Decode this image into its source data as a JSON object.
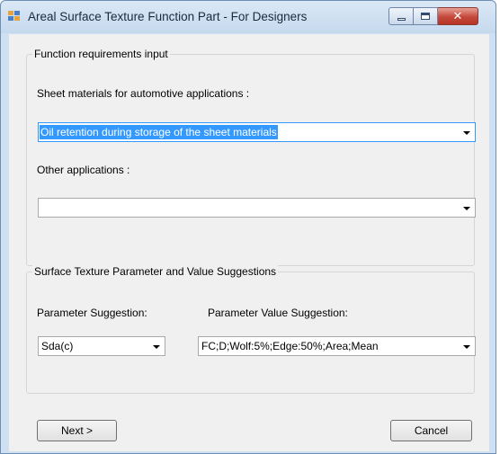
{
  "window": {
    "title": "Areal Surface Texture Function Part - For Designers",
    "close_glyph": "✕"
  },
  "function_group": {
    "legend": "Function requirements input",
    "sheet_label": "Sheet materials for automotive applications :",
    "sheet_value": "Oil retention during storage of the sheet materials",
    "other_label": "Other applications :",
    "other_value": ""
  },
  "suggestion_group": {
    "legend": "Surface Texture Parameter and Value Suggestions",
    "param_label": "Parameter Suggestion:",
    "param_value": "Sda(c)",
    "value_label": "Parameter Value Suggestion:",
    "value_value": "FC;D;Wolf:5%;Edge:50%;Area;Mean"
  },
  "buttons": {
    "next": "Next >",
    "cancel": "Cancel"
  },
  "colors": {
    "selection": "#3399ff",
    "title_bar": "#c5d9ee",
    "close_button": "#c4483a"
  },
  "icons": {
    "app": "app-window-icon",
    "minimize": "minimize-icon",
    "maximize": "maximize-icon",
    "close": "close-icon",
    "dropdown": "chevron-down-icon"
  }
}
